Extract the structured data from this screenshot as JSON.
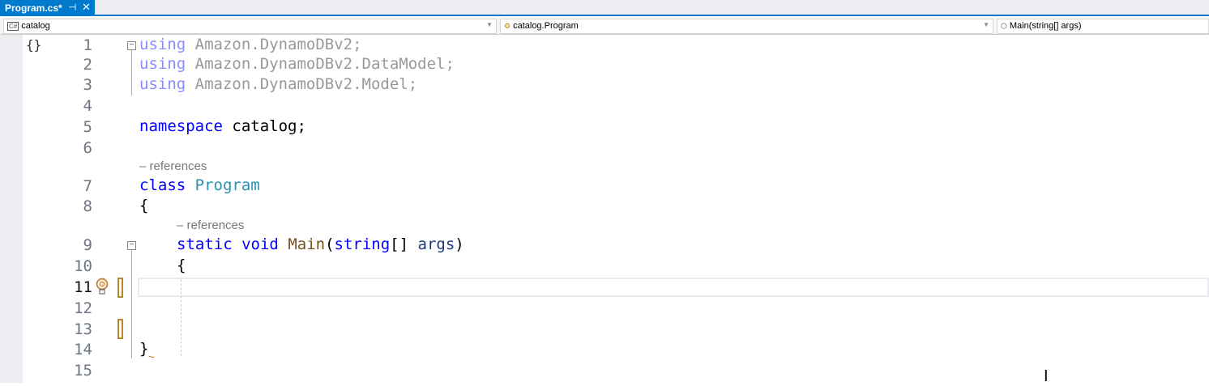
{
  "tab": {
    "title": "Program.cs*",
    "pin": "⊣",
    "close": "✕"
  },
  "nav": {
    "project": "catalog",
    "type": "catalog.Program",
    "member": "Main(string[] args)",
    "project_icon": "C#"
  },
  "lines": [
    "1",
    "2",
    "3",
    "4",
    "5",
    "6",
    "7",
    "8",
    "9",
    "10",
    "11",
    "12",
    "13",
    "14",
    "15"
  ],
  "code": {
    "l1_kw": "using",
    "l1_rest": " Amazon.DynamoDBv2;",
    "l2_kw": "using",
    "l2_rest": " Amazon.DynamoDBv2.DataModel;",
    "l3_kw": "using",
    "l3_rest": " Amazon.DynamoDBv2.Model;",
    "l5_kw": "namespace",
    "l5_rest": " catalog;",
    "ref1": "– references",
    "l7_kw": "class",
    "l7_type": "Program",
    "l8": "{",
    "ref2": "– references",
    "l9_kw1": "static",
    "l9_kw2": "void",
    "l9_fn": "Main",
    "l9_p1": "(",
    "l9_kw3": "string",
    "l9_p2": "[] ",
    "l9_param": "args",
    "l9_p3": ")",
    "l10": "{",
    "l14": "}"
  },
  "gutter_glyph": "{}"
}
